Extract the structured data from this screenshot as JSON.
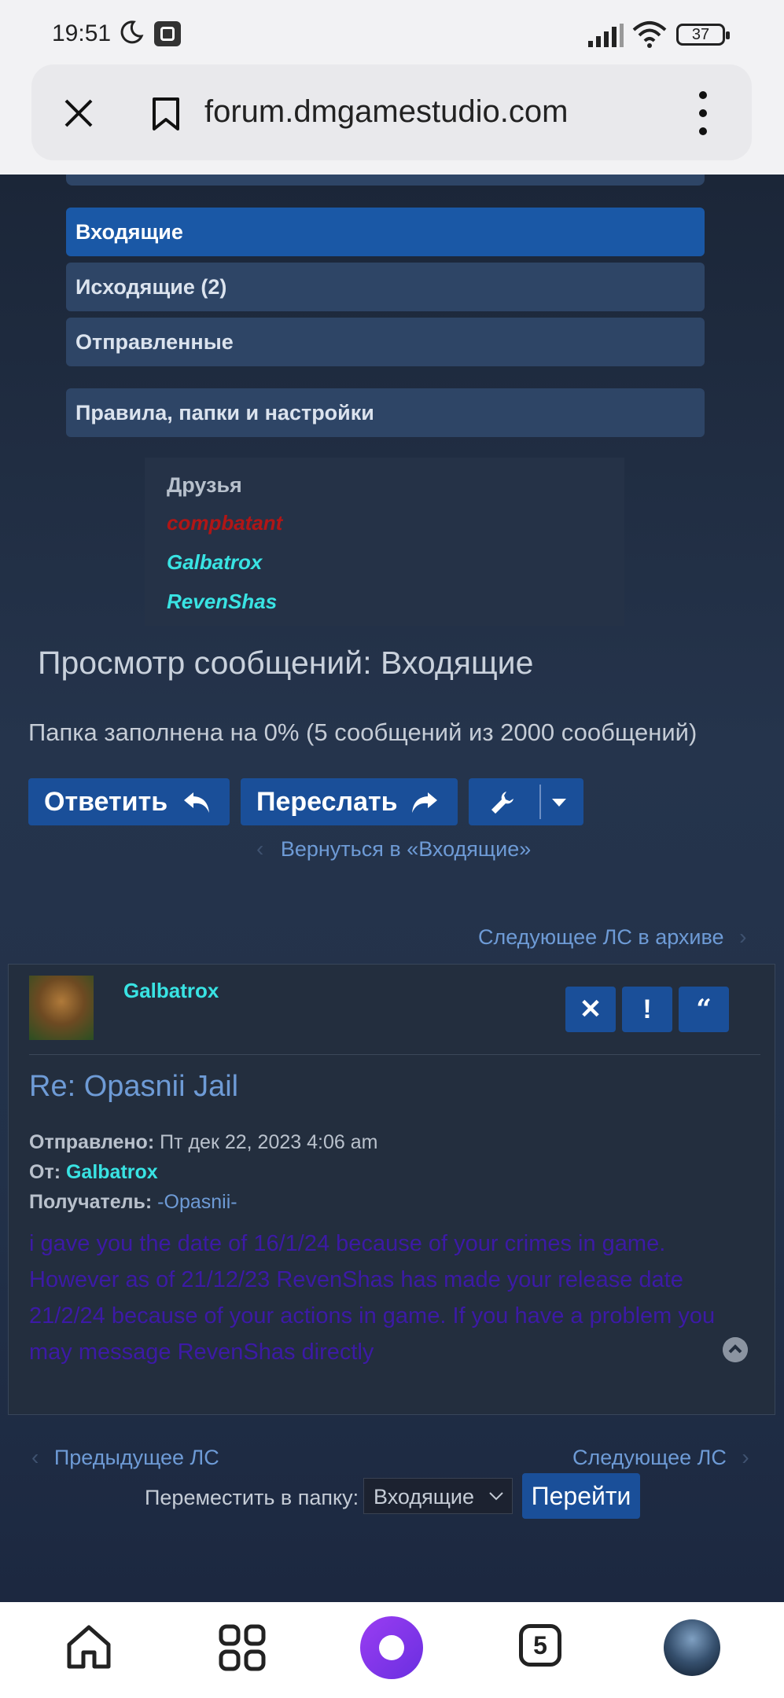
{
  "status_bar": {
    "time": "19:51",
    "battery": "37"
  },
  "browser": {
    "url": "forum.dmgamestudio.com"
  },
  "nav": {
    "inbox": "Входящие",
    "outbox": "Исходящие (2)",
    "sent": "Отправленные",
    "rules": "Правила, папки и настройки"
  },
  "friends": {
    "title": "Друзья",
    "list": [
      "compbatant",
      "Galbatrox",
      "RevenShas"
    ],
    "colors": [
      "#b01616",
      "#39e3e3",
      "#39e3e3"
    ]
  },
  "page": {
    "title": "Просмотр сообщений: Входящие",
    "folder_info": "Папка заполнена на 0% (5 сообщений из 2000 сообщений)",
    "reply_button": "Ответить",
    "forward_button": "Переслать",
    "back_link": "Вернуться в «Входящие»",
    "next_in_archive": "Следующее ЛС в архиве"
  },
  "post": {
    "author": "Galbatrox",
    "subject": "Re: Opasnii Jail",
    "sent_label": "Отправлено:",
    "sent_value": "Пт дек 22, 2023 4:06 am",
    "from_label": "От:",
    "from_value": "Galbatrox",
    "to_label": "Получатель:",
    "to_value": "-Opasnii-",
    "body": "i gave you the date of 16/1/24 because of your crimes in game. However as of 21/12/23 RevenShas has made your release date 21/2/24 because of your actions in game. If you have a problem you may message RevenShas directly"
  },
  "footer": {
    "prev": "Предыдущее ЛС",
    "next": "Следующее ЛС",
    "move_label": "Переместить в папку:",
    "folder_select": "Входящие",
    "go_button": "Перейти"
  },
  "bottom_nav": {
    "tabs_count": "5"
  },
  "colors": {
    "accent": "#1a4f99",
    "nav_active": "#1a58a6",
    "link": "#6e9bd6",
    "friend_user": "#39e3e3",
    "body_text": "#3c1aa6"
  }
}
